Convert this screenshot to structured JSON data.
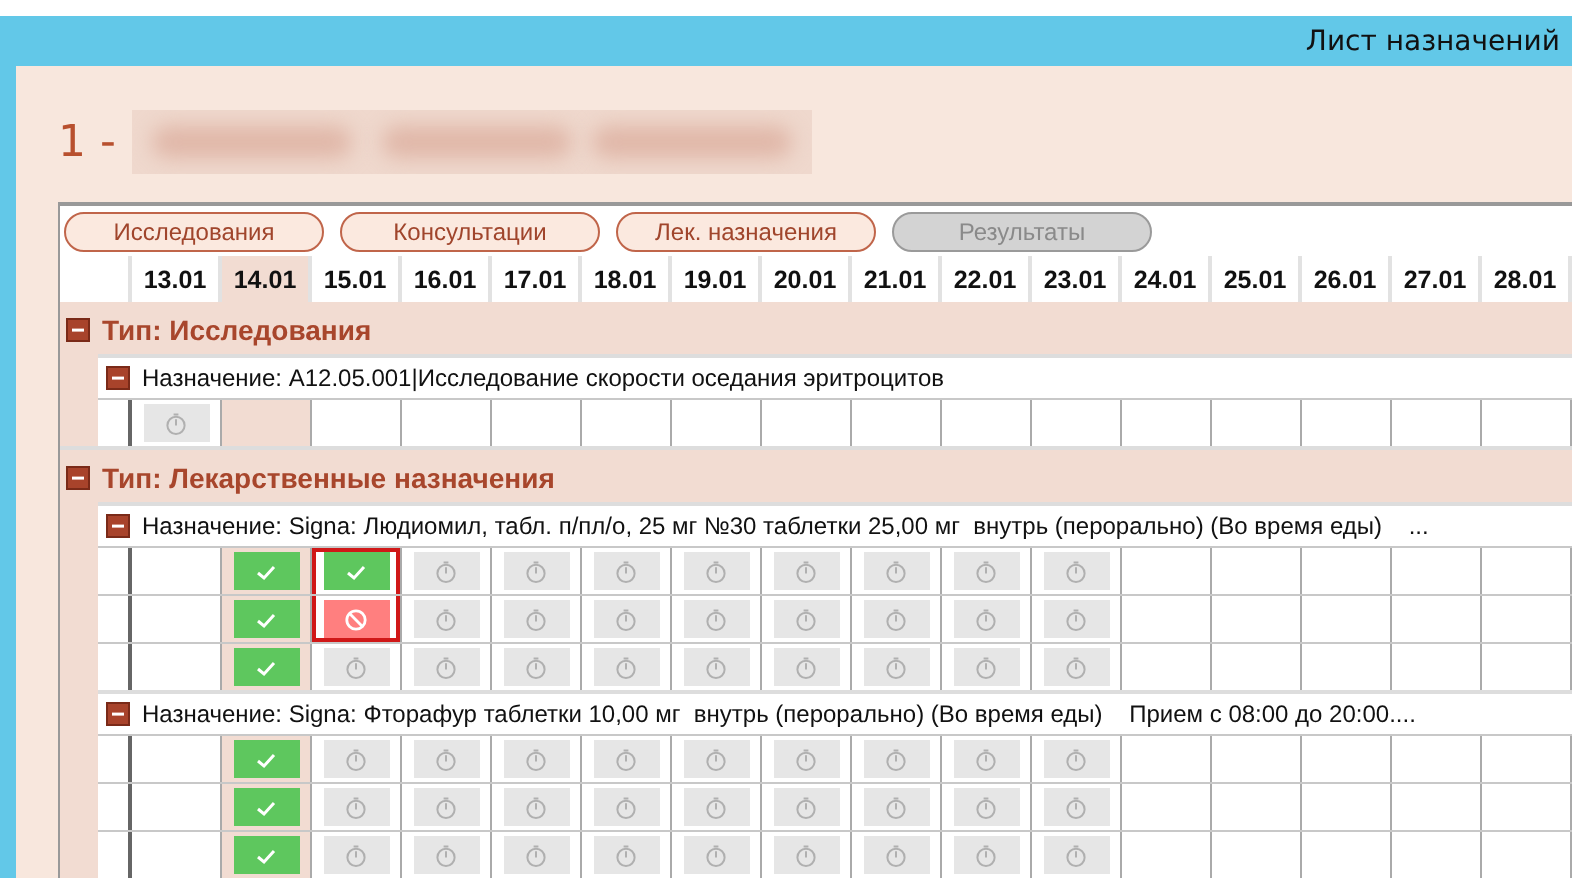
{
  "window": {
    "title": "Лист назначений"
  },
  "patient": {
    "number": "1 -"
  },
  "filter_buttons": [
    {
      "label": "Исследования",
      "disabled": false
    },
    {
      "label": "Консультации",
      "disabled": false
    },
    {
      "label": "Лек. назначения",
      "disabled": false
    },
    {
      "label": "Результаты",
      "disabled": true
    }
  ],
  "dates": [
    {
      "label": "13.01",
      "selected": false
    },
    {
      "label": "14.01",
      "selected": true
    },
    {
      "label": "15.01",
      "selected": false
    },
    {
      "label": "16.01",
      "selected": false
    },
    {
      "label": "17.01",
      "selected": false
    },
    {
      "label": "18.01",
      "selected": false
    },
    {
      "label": "19.01",
      "selected": false
    },
    {
      "label": "20.01",
      "selected": false
    },
    {
      "label": "21.01",
      "selected": false
    },
    {
      "label": "22.01",
      "selected": false
    },
    {
      "label": "23.01",
      "selected": false
    },
    {
      "label": "24.01",
      "selected": false
    },
    {
      "label": "25.01",
      "selected": false
    },
    {
      "label": "26.01",
      "selected": false
    },
    {
      "label": "27.01",
      "selected": false
    },
    {
      "label": "28.01",
      "selected": false
    }
  ],
  "groups": [
    {
      "title": "Тип: Исследования",
      "expanded": true,
      "prescriptions": [
        {
          "title": "Назначение: A12.05.001|Исследование скорости оседания эритроцитов",
          "expanded": true,
          "rows": [
            {
              "cells": [
                {
                  "kind": "pending",
                  "framed": false
                },
                {
                  "kind": "empty",
                  "framed": false
                },
                {
                  "kind": "empty",
                  "framed": false
                },
                {
                  "kind": "empty",
                  "framed": false
                },
                {
                  "kind": "empty",
                  "framed": false
                },
                {
                  "kind": "empty",
                  "framed": false
                },
                {
                  "kind": "empty",
                  "framed": false
                },
                {
                  "kind": "empty",
                  "framed": false
                },
                {
                  "kind": "empty",
                  "framed": false
                },
                {
                  "kind": "empty",
                  "framed": false
                },
                {
                  "kind": "empty",
                  "framed": false
                },
                {
                  "kind": "empty",
                  "framed": false
                },
                {
                  "kind": "empty",
                  "framed": false
                },
                {
                  "kind": "empty",
                  "framed": false
                },
                {
                  "kind": "empty",
                  "framed": false
                },
                {
                  "kind": "empty",
                  "framed": false
                }
              ]
            }
          ]
        }
      ]
    },
    {
      "title": "Тип: Лекарственные назначения",
      "expanded": true,
      "prescriptions": [
        {
          "title": "Назначение: Signa: Людиомил, табл. п/пл/о, 25 мг №30 таблетки 25,00 мг  внутрь (перорально) (Во время еды)    ...",
          "expanded": true,
          "rows": [
            {
              "cells": [
                {
                  "kind": "empty",
                  "framed": false
                },
                {
                  "kind": "done",
                  "framed": false
                },
                {
                  "kind": "done",
                  "framed": true
                },
                {
                  "kind": "pending",
                  "framed": false
                },
                {
                  "kind": "pending",
                  "framed": false
                },
                {
                  "kind": "pending",
                  "framed": false
                },
                {
                  "kind": "pending",
                  "framed": false
                },
                {
                  "kind": "pending",
                  "framed": false
                },
                {
                  "kind": "pending",
                  "framed": false
                },
                {
                  "kind": "pending",
                  "framed": false
                },
                {
                  "kind": "pending",
                  "framed": false
                },
                {
                  "kind": "empty",
                  "framed": false
                },
                {
                  "kind": "empty",
                  "framed": false
                },
                {
                  "kind": "empty",
                  "framed": false
                },
                {
                  "kind": "empty",
                  "framed": false
                },
                {
                  "kind": "empty",
                  "framed": false
                }
              ]
            },
            {
              "cells": [
                {
                  "kind": "empty",
                  "framed": false
                },
                {
                  "kind": "done",
                  "framed": false
                },
                {
                  "kind": "cancelled",
                  "framed": true
                },
                {
                  "kind": "pending",
                  "framed": false
                },
                {
                  "kind": "pending",
                  "framed": false
                },
                {
                  "kind": "pending",
                  "framed": false
                },
                {
                  "kind": "pending",
                  "framed": false
                },
                {
                  "kind": "pending",
                  "framed": false
                },
                {
                  "kind": "pending",
                  "framed": false
                },
                {
                  "kind": "pending",
                  "framed": false
                },
                {
                  "kind": "pending",
                  "framed": false
                },
                {
                  "kind": "empty",
                  "framed": false
                },
                {
                  "kind": "empty",
                  "framed": false
                },
                {
                  "kind": "empty",
                  "framed": false
                },
                {
                  "kind": "empty",
                  "framed": false
                },
                {
                  "kind": "empty",
                  "framed": false
                }
              ]
            },
            {
              "cells": [
                {
                  "kind": "empty",
                  "framed": false
                },
                {
                  "kind": "done",
                  "framed": false
                },
                {
                  "kind": "pending",
                  "framed": false
                },
                {
                  "kind": "pending",
                  "framed": false
                },
                {
                  "kind": "pending",
                  "framed": false
                },
                {
                  "kind": "pending",
                  "framed": false
                },
                {
                  "kind": "pending",
                  "framed": false
                },
                {
                  "kind": "pending",
                  "framed": false
                },
                {
                  "kind": "pending",
                  "framed": false
                },
                {
                  "kind": "pending",
                  "framed": false
                },
                {
                  "kind": "pending",
                  "framed": false
                },
                {
                  "kind": "empty",
                  "framed": false
                },
                {
                  "kind": "empty",
                  "framed": false
                },
                {
                  "kind": "empty",
                  "framed": false
                },
                {
                  "kind": "empty",
                  "framed": false
                },
                {
                  "kind": "empty",
                  "framed": false
                }
              ]
            }
          ]
        },
        {
          "title": "Назначение: Signa: Фторафур таблетки 10,00 мг  внутрь (перорально) (Во время еды)    Прием с 08:00 до 20:00....",
          "expanded": true,
          "rows": [
            {
              "cells": [
                {
                  "kind": "empty",
                  "framed": false
                },
                {
                  "kind": "done",
                  "framed": false
                },
                {
                  "kind": "pending",
                  "framed": false
                },
                {
                  "kind": "pending",
                  "framed": false
                },
                {
                  "kind": "pending",
                  "framed": false
                },
                {
                  "kind": "pending",
                  "framed": false
                },
                {
                  "kind": "pending",
                  "framed": false
                },
                {
                  "kind": "pending",
                  "framed": false
                },
                {
                  "kind": "pending",
                  "framed": false
                },
                {
                  "kind": "pending",
                  "framed": false
                },
                {
                  "kind": "pending",
                  "framed": false
                },
                {
                  "kind": "empty",
                  "framed": false
                },
                {
                  "kind": "empty",
                  "framed": false
                },
                {
                  "kind": "empty",
                  "framed": false
                },
                {
                  "kind": "empty",
                  "framed": false
                },
                {
                  "kind": "empty",
                  "framed": false
                }
              ]
            },
            {
              "cells": [
                {
                  "kind": "empty",
                  "framed": false
                },
                {
                  "kind": "done",
                  "framed": false
                },
                {
                  "kind": "pending",
                  "framed": false
                },
                {
                  "kind": "pending",
                  "framed": false
                },
                {
                  "kind": "pending",
                  "framed": false
                },
                {
                  "kind": "pending",
                  "framed": false
                },
                {
                  "kind": "pending",
                  "framed": false
                },
                {
                  "kind": "pending",
                  "framed": false
                },
                {
                  "kind": "pending",
                  "framed": false
                },
                {
                  "kind": "pending",
                  "framed": false
                },
                {
                  "kind": "pending",
                  "framed": false
                },
                {
                  "kind": "empty",
                  "framed": false
                },
                {
                  "kind": "empty",
                  "framed": false
                },
                {
                  "kind": "empty",
                  "framed": false
                },
                {
                  "kind": "empty",
                  "framed": false
                },
                {
                  "kind": "empty",
                  "framed": false
                }
              ]
            },
            {
              "cells": [
                {
                  "kind": "empty",
                  "framed": false
                },
                {
                  "kind": "done",
                  "framed": false
                },
                {
                  "kind": "pending",
                  "framed": false
                },
                {
                  "kind": "pending",
                  "framed": false
                },
                {
                  "kind": "pending",
                  "framed": false
                },
                {
                  "kind": "pending",
                  "framed": false
                },
                {
                  "kind": "pending",
                  "framed": false
                },
                {
                  "kind": "pending",
                  "framed": false
                },
                {
                  "kind": "pending",
                  "framed": false
                },
                {
                  "kind": "pending",
                  "framed": false
                },
                {
                  "kind": "pending",
                  "framed": false
                },
                {
                  "kind": "empty",
                  "framed": false
                },
                {
                  "kind": "empty",
                  "framed": false
                },
                {
                  "kind": "empty",
                  "framed": false
                },
                {
                  "kind": "empty",
                  "framed": false
                },
                {
                  "kind": "empty",
                  "framed": false
                }
              ]
            }
          ]
        }
      ]
    }
  ]
}
